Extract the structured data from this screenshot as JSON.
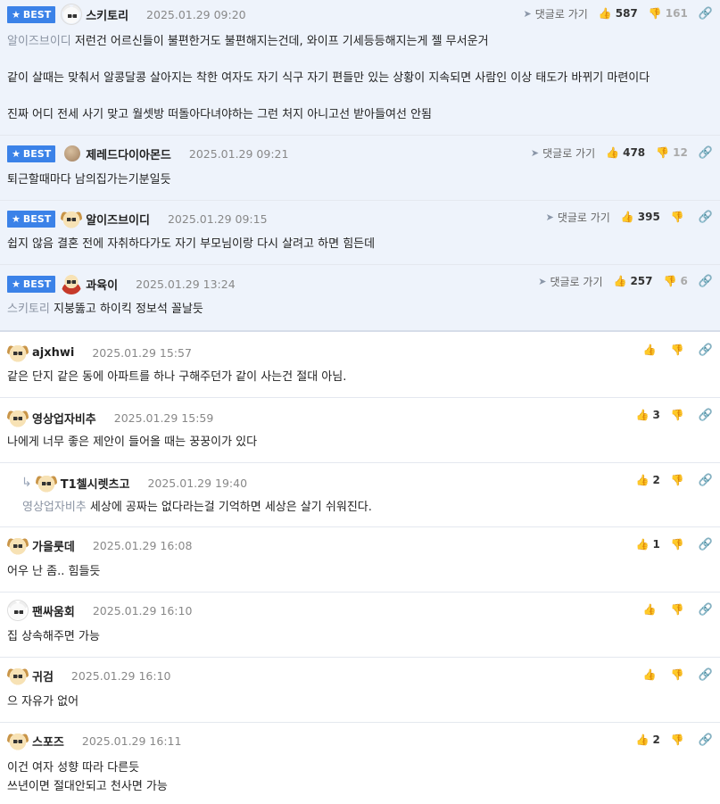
{
  "labels": {
    "best": "BEST",
    "goto": "댓글로 가기"
  },
  "comments": [
    {
      "nick": "스키토리",
      "date": "2025.01.29 09:20",
      "up": "587",
      "down": "161",
      "mention": "알이즈브이디",
      "text": "저런건 어르신들이 불편한거도 불편해지는건데, 와이프 기세등등해지는게 젤 무서운거\n\n같이 살때는 맞춰서 알콩달콩 살아지는 착한 여자도 자기 식구 자기 편들만 있는 상황이 지속되면 사람인 이상 태도가 바뀌기 마련이다\n\n진짜 어디 전세 사기 맞고 월셋방 떠돌아다녀야하는 그런 처지 아니고선 받아들여선 안됨"
    },
    {
      "nick": "제레드다이아몬드",
      "date": "2025.01.29 09:21",
      "up": "478",
      "down": "12",
      "mention": "",
      "text": "퇴근할때마다 남의집가는기분일듯"
    },
    {
      "nick": "알이즈브이디",
      "date": "2025.01.29 09:15",
      "up": "395",
      "down": "",
      "mention": "",
      "text": "쉽지 않음 결혼 전에 자취하다가도 자기 부모님이랑 다시 살려고 하면 힘든데"
    },
    {
      "nick": "과육이",
      "date": "2025.01.29 13:24",
      "up": "257",
      "down": "6",
      "mention": "스키토리",
      "text": "지붕뚫고 하이킥 정보석 꼴날듯"
    },
    {
      "nick": "ajxhwi",
      "date": "2025.01.29 15:57",
      "up": "",
      "down": "",
      "mention": "",
      "text": "같은 단지 같은 동에 아파트를 하나 구해주던가 같이 사는건 절대 아님."
    },
    {
      "nick": "영상업자비추",
      "date": "2025.01.29 15:59",
      "up": "3",
      "down": "",
      "mention": "",
      "text": "나에게 너무 좋은 제안이 들어올 때는 꿍꿍이가 있다"
    },
    {
      "nick": "T1첼시렛츠고",
      "date": "2025.01.29 19:40",
      "up": "2",
      "down": "",
      "mention": "영상업자비추",
      "text": "세상에 공짜는 없다라는걸 기억하면 세상은 살기 쉬워진다."
    },
    {
      "nick": "가을룻데",
      "date": "2025.01.29 16:08",
      "up": "1",
      "down": "",
      "mention": "",
      "text": "어우 난 좀.. 힘들듯"
    },
    {
      "nick": "팬싸움회",
      "date": "2025.01.29 16:10",
      "up": "",
      "down": "",
      "mention": "",
      "text": "집 상속해주면 가능"
    },
    {
      "nick": "귀검",
      "date": "2025.01.29 16:10",
      "up": "",
      "down": "",
      "mention": "",
      "text": "으 자유가 없어"
    },
    {
      "nick": "스포즈",
      "date": "2025.01.29 16:11",
      "up": "2",
      "down": "",
      "mention": "",
      "text": "이건 여자 성향 따라 다른듯\n쓰년이면 절대안되고 천사면 가능"
    }
  ]
}
